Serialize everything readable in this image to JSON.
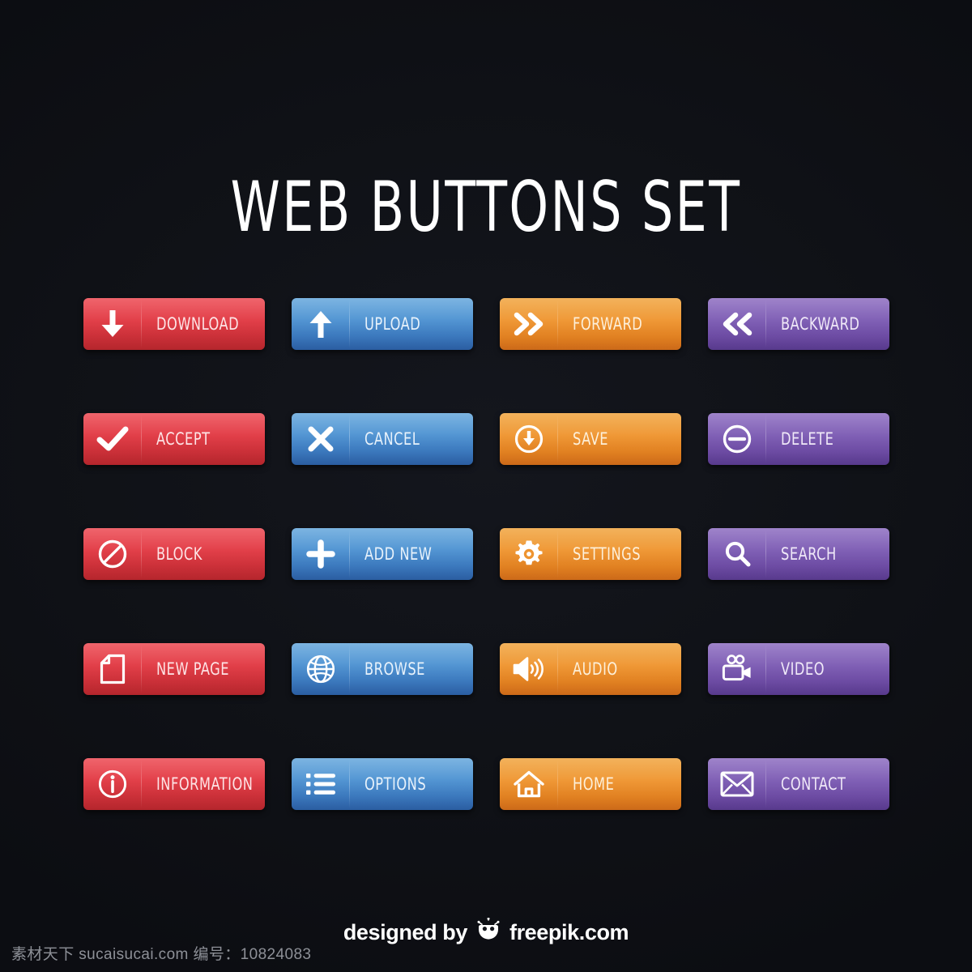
{
  "page": {
    "title": "WEB BUTTONS SET",
    "background_color": "#0f1116"
  },
  "palette": {
    "red": "#e23a44",
    "blue": "#4e93d2",
    "orange": "#ef9631",
    "purple": "#7d5cb4",
    "label_color": "#ffffff"
  },
  "buttons": [
    {
      "label": "DOWNLOAD",
      "icon": "arrow-down-icon",
      "color": "red"
    },
    {
      "label": "UPLOAD",
      "icon": "arrow-up-icon",
      "color": "blue"
    },
    {
      "label": "FORWARD",
      "icon": "chevron-double-right-icon",
      "color": "orange"
    },
    {
      "label": "BACKWARD",
      "icon": "chevron-double-left-icon",
      "color": "purple"
    },
    {
      "label": "ACCEPT",
      "icon": "check-icon",
      "color": "red"
    },
    {
      "label": "CANCEL",
      "icon": "close-x-icon",
      "color": "blue"
    },
    {
      "label": "SAVE",
      "icon": "circle-arrow-down-icon",
      "color": "orange"
    },
    {
      "label": "DELETE",
      "icon": "circle-minus-icon",
      "color": "purple"
    },
    {
      "label": "BLOCK",
      "icon": "no-entry-icon",
      "color": "red"
    },
    {
      "label": "ADD NEW",
      "icon": "plus-icon",
      "color": "blue"
    },
    {
      "label": "SETTINGS",
      "icon": "gear-icon",
      "color": "orange"
    },
    {
      "label": "SEARCH",
      "icon": "magnifier-icon",
      "color": "purple"
    },
    {
      "label": "NEW PAGE",
      "icon": "document-page-icon",
      "color": "red"
    },
    {
      "label": "BROWSE",
      "icon": "globe-icon",
      "color": "blue"
    },
    {
      "label": "AUDIO",
      "icon": "speaker-volume-icon",
      "color": "orange"
    },
    {
      "label": "VIDEO",
      "icon": "video-camera-icon",
      "color": "purple"
    },
    {
      "label": "INFORMATION",
      "icon": "info-circle-icon",
      "color": "red"
    },
    {
      "label": "OPTIONS",
      "icon": "bullet-list-icon",
      "color": "blue"
    },
    {
      "label": "HOME",
      "icon": "home-icon",
      "color": "orange"
    },
    {
      "label": "CONTACT",
      "icon": "envelope-icon",
      "color": "purple"
    }
  ],
  "footer": {
    "prefix": "designed by",
    "brand": "freepik.com",
    "logo": "freepik-logo-icon"
  },
  "watermark": {
    "text": "素材天下 sucaisucai.com  编号：10824083"
  }
}
